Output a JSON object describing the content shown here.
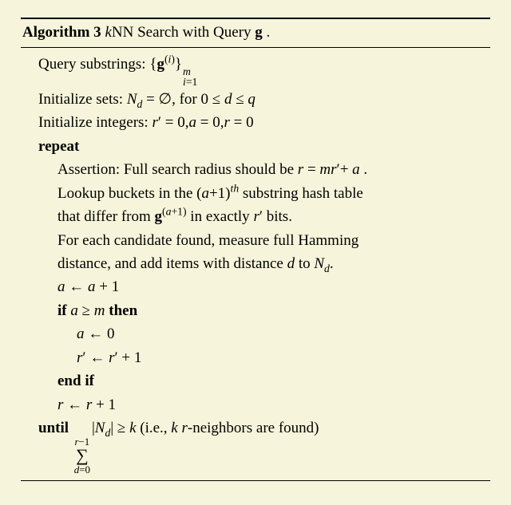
{
  "title": {
    "label": "Algorithm 3",
    "name_pre": "k",
    "name_post": "NN Search with Query ",
    "name_sym": "g",
    "name_end": " ."
  },
  "lines": {
    "l1_a": "Query substrings: {",
    "l1_g": "g",
    "l1_supi": "(",
    "l1_supi_i": "i",
    "l1_supi_close": ")",
    "l1_sub_i": "i",
    "l1_sub_eq1": "=1",
    "l1_sup_m": "m",
    "l2_a": "Initialize sets: ",
    "l2_Nd": "N",
    "l2_d": "d",
    "l2_eq": " = ∅, for 0 ≤ ",
    "l2_dv": "d",
    "l2_leq": " ≤ ",
    "l2_q": "q",
    "l3_a": "Initialize integers: ",
    "l3_rp": "r",
    "l3_prime": "′",
    "l3_eq0a": " = 0,",
    "l3_a2": "a",
    "l3_eq0b": " = 0,",
    "l3_r": "r",
    "l3_eq0c": " = 0",
    "repeat": "repeat",
    "l5_a": "Assertion: Full search radius should be ",
    "l5_r": "r",
    "l5_eq": " = ",
    "l5_mr": "mr",
    "l5_p": "′",
    "l5_plus": "+ ",
    "l5_a2": "a",
    "l5_dot": " .",
    "l6_a": "Lookup buckets in the (",
    "l6_a2": "a",
    "l6_p1": "+1)",
    "l6_th": "th",
    "l6_b": " substring hash table",
    "l7_a": "that differ from ",
    "l7_g": "g",
    "l7_sup_open": "(",
    "l7_sup_a": "a",
    "l7_sup_close": "+1)",
    "l7_b": " in exactly ",
    "l7_rp": "r",
    "l7_prime": "′",
    "l7_bits": " bits.",
    "l8": "For each candidate found, measure full Hamming",
    "l9_a": "distance, and add items with distance ",
    "l9_d": "d",
    "l9_b": " to ",
    "l9_N": "N",
    "l9_Nd": "d",
    "l9_dot": ".",
    "l10_a": "a",
    "l10_arrow": " ← ",
    "l10_b": "a",
    "l10_p1": " + 1",
    "if": "if ",
    "l11_a": " a",
    "l11_geq": " ≥ ",
    "l11_m": "m",
    "l11_then": " then",
    "l12_a": "a",
    "l12_arrow": " ← 0",
    "l13_r": "r",
    "l13_p": "′",
    "l13_arrow": " ← ",
    "l13_r2": "r",
    "l13_p2": "′",
    "l13_p1": " + 1",
    "endif": "end if",
    "l15_r": "r",
    "l15_arrow": " ← ",
    "l15_r2": "r",
    "l15_p1": " + 1",
    "until": "until  ",
    "sum_top_r": "r",
    "sum_top_m1": "−1",
    "sum_sigma": "∑",
    "sum_bot_d": "d",
    "sum_bot_eq0": "=0",
    "l16_absN": "|",
    "l16_N": "N",
    "l16_Nd": "d",
    "l16_absC": "|",
    "l16_geq": " ≥ ",
    "l16_k": "k",
    "l16_ie_a": "  (i.e., ",
    "l16_k2": "k",
    "l16_sp": " ",
    "l16_r": "r",
    "l16_ie_b": "-neighbors are found)"
  }
}
